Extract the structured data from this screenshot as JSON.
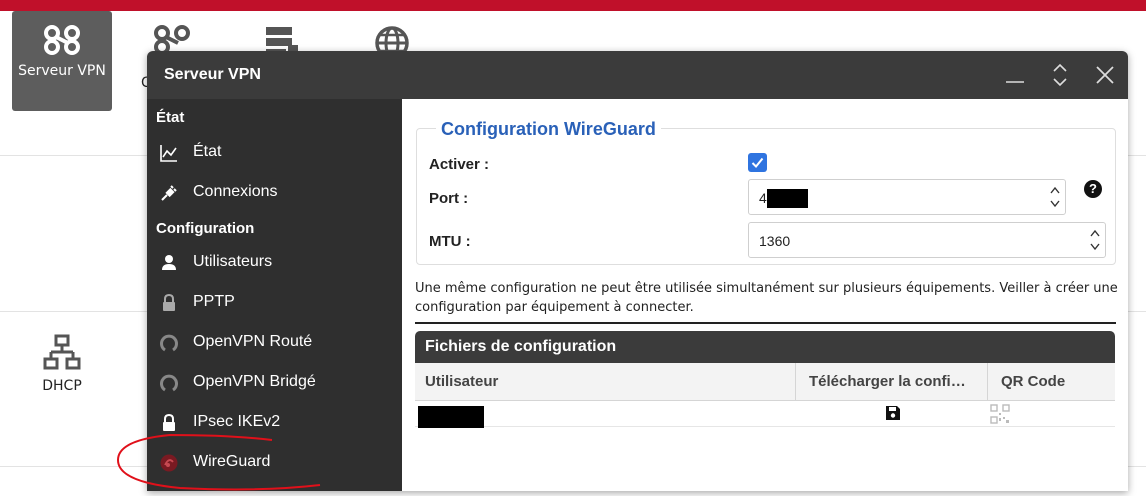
{
  "desktop": {
    "tiles": [
      {
        "label": "Serveur VPN",
        "icon": "vpn-icon"
      },
      {
        "label": "C",
        "icon": "vpn-client-icon"
      },
      {
        "label": "",
        "icon": "server-shield-icon"
      },
      {
        "label": "",
        "icon": "globe-icon"
      },
      {
        "label": "DHCP",
        "icon": "network-icon"
      }
    ],
    "accent_color": "#c0102a"
  },
  "window": {
    "title": "Serveur VPN",
    "controls": [
      "minimize-icon",
      "maximize-icon",
      "close-icon"
    ]
  },
  "sidebar": {
    "sections": [
      {
        "title": "État",
        "items": [
          {
            "label": "État",
            "icon": "chart-line-icon"
          },
          {
            "label": "Connexions",
            "icon": "plug-icon"
          }
        ]
      },
      {
        "title": "Configuration",
        "items": [
          {
            "label": "Utilisateurs",
            "icon": "user-icon"
          },
          {
            "label": "PPTP",
            "icon": "lock-icon"
          },
          {
            "label": "OpenVPN Routé",
            "icon": "openvpn-icon"
          },
          {
            "label": "OpenVPN Bridgé",
            "icon": "openvpn-icon"
          },
          {
            "label": "IPsec IKEv2",
            "icon": "lock-icon"
          },
          {
            "label": "WireGuard",
            "icon": "wireguard-icon"
          }
        ]
      }
    ]
  },
  "config": {
    "legend": "Configuration WireGuard",
    "enable_label": "Activer :",
    "enable_checked": true,
    "port_label": "Port :",
    "port_value": "4",
    "mtu_label": "MTU :",
    "mtu_value": "1360",
    "checkbox_color": "#2f74e0",
    "legend_color": "#2a61b8"
  },
  "note": "Une même configuration ne peut être utilisée simultanément sur plusieurs équipements. Veiller à créer une configuration par équipement à connecter.",
  "files": {
    "title": "Fichiers de configuration",
    "columns": [
      "Utilisateur",
      "Télécharger la confi…",
      "QR Code"
    ],
    "rows": [
      {
        "user": "",
        "download_icon": "floppy-disk-icon",
        "qr_icon": "qr-code-icon"
      }
    ]
  }
}
